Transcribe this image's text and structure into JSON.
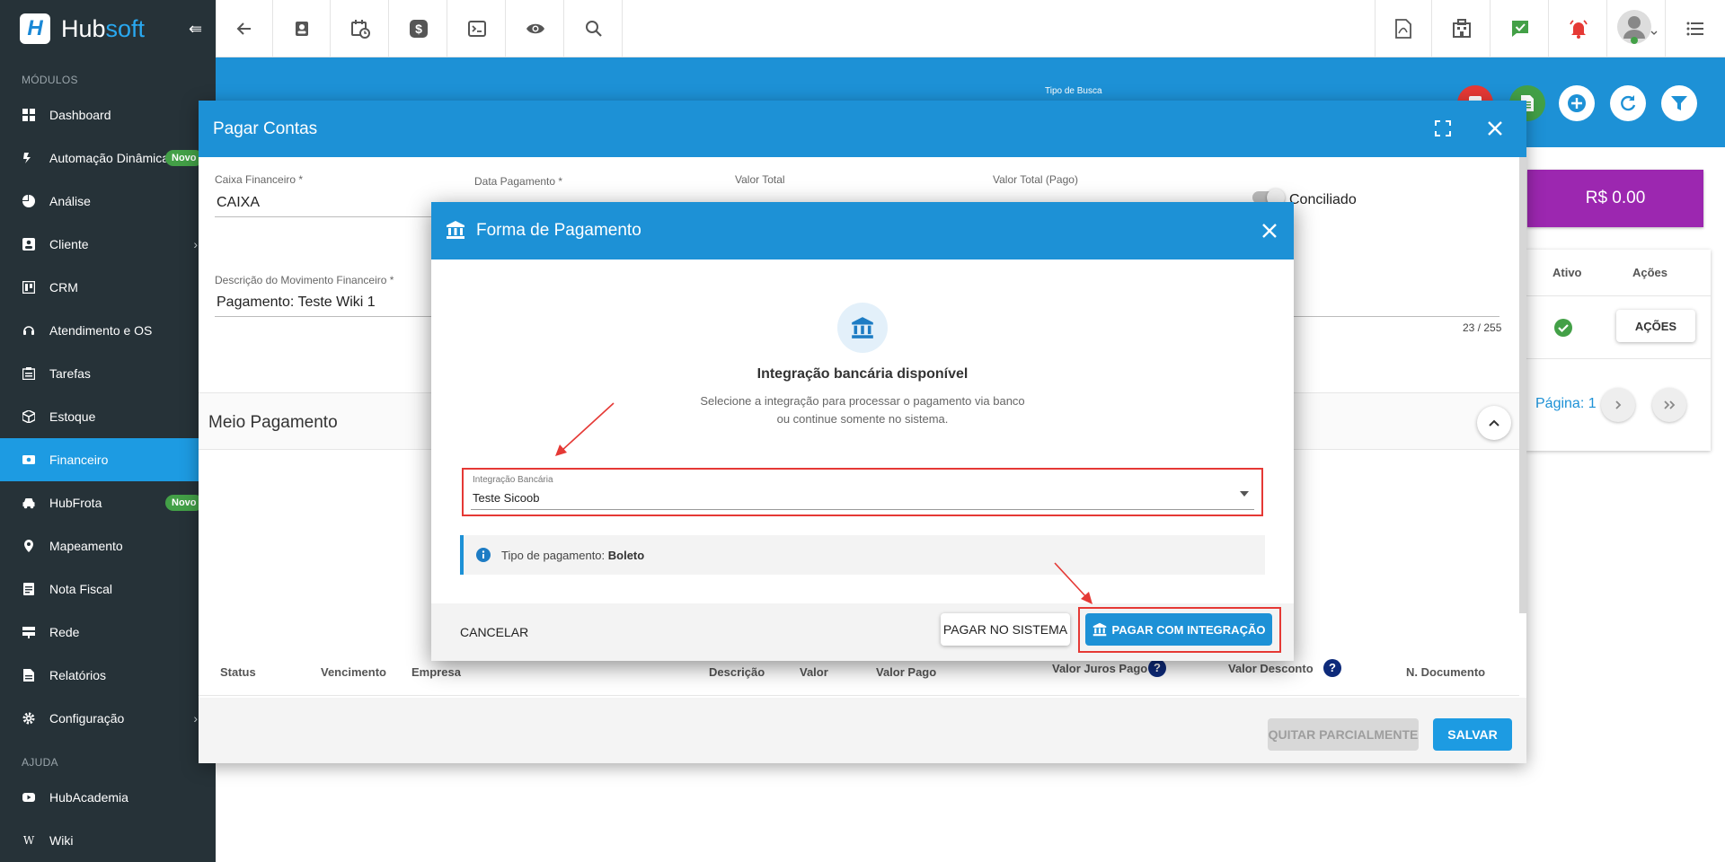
{
  "sidebar": {
    "brand": {
      "hub": "Hub",
      "soft": "soft"
    },
    "section_modules": "MÓDULOS",
    "section_help": "AJUDA",
    "items": [
      {
        "label": "Dashboard"
      },
      {
        "label": "Automação Dinâmica",
        "badge": "Novo"
      },
      {
        "label": "Análise"
      },
      {
        "label": "Cliente"
      },
      {
        "label": "CRM"
      },
      {
        "label": "Atendimento e OS"
      },
      {
        "label": "Tarefas"
      },
      {
        "label": "Estoque"
      },
      {
        "label": "Financeiro"
      },
      {
        "label": "HubFrota",
        "badge": "Novo"
      },
      {
        "label": "Mapeamento"
      },
      {
        "label": "Nota Fiscal"
      },
      {
        "label": "Rede"
      },
      {
        "label": "Relatórios"
      },
      {
        "label": "Configuração"
      }
    ],
    "help_items": [
      {
        "label": "HubAcademia"
      },
      {
        "label": "Wiki"
      }
    ]
  },
  "background": {
    "tipo_busca": "Tipo de Busca",
    "total": "R$ 0.00",
    "table": {
      "col_ativo": "Ativo",
      "col_acoes": "Ações",
      "acoes_button": "AÇÕES",
      "page_label": "Página: 1"
    }
  },
  "main_dialog": {
    "title": "Pagar Contas",
    "caixa_label": "Caixa Financeiro *",
    "caixa_value": "CAIXA",
    "data_label": "Data Pagamento *",
    "valor_total_label": "Valor Total",
    "valor_pago_label": "Valor Total (Pago)",
    "conciliado_label": "Conciliado",
    "descricao_label": "Descrição do Movimento Financeiro *",
    "descricao_value": "Pagamento: Teste Wiki 1",
    "char_counter": "23 / 255",
    "meio_title": "Meio Pagamento",
    "table_headers": {
      "status": "Status",
      "vencimento": "Vencimento",
      "empresa": "Empresa",
      "descricao": "Descrição",
      "valor": "Valor",
      "valor_pago": "Valor Pago",
      "juros": "Valor Juros Pago",
      "desconto": "Valor Desconto",
      "documento": "N. Documento"
    },
    "help_mark": "?",
    "quitar_button": "QUITAR PARCIALMENTE",
    "salvar_button": "SALVAR"
  },
  "payment_dialog": {
    "title": "Forma de Pagamento",
    "heading": "Integração bancária disponível",
    "subtitle_line1": "Selecione a integração para processar o pagamento via banco",
    "subtitle_line2": "ou continue somente no sistema.",
    "integration_label": "Integração Bancária",
    "integration_value": "Teste Sicoob",
    "info_prefix": "Tipo de pagamento: ",
    "info_value": "Boleto",
    "cancel_button": "CANCELAR",
    "system_button": "PAGAR NO SISTEMA",
    "integration_button": "PAGAR COM INTEGRAÇÃO"
  },
  "colors": {
    "primary": "#1d91d6",
    "sidebar": "#263238",
    "active": "#1d9be2",
    "badge": "#43a047",
    "highlight": "#e53935",
    "total_card": "#9c27b0"
  }
}
